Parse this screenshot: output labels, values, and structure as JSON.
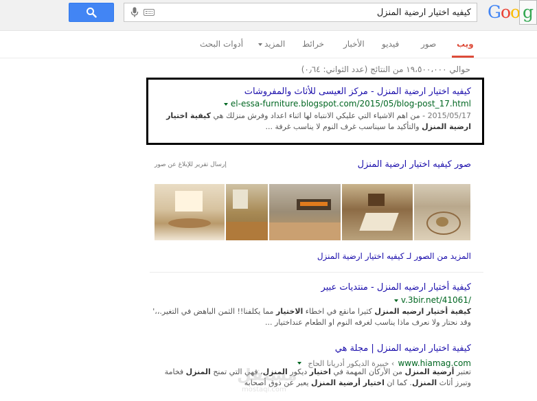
{
  "search": {
    "query": "كيفيه اختيار ارضية المنزل",
    "logo_text": "Goo"
  },
  "tabs": [
    {
      "label": "ويب",
      "active": true
    },
    {
      "label": "صور"
    },
    {
      "label": "فيديو"
    },
    {
      "label": "الأخبار"
    },
    {
      "label": "خرائط"
    },
    {
      "label": "المزيد"
    },
    {
      "label": "أدوات البحث"
    }
  ],
  "stats": "حوالي ١٩،٥٠٠،٠٠٠ من النتائج (عدد الثواني: ٠٫٦٤)",
  "result1": {
    "title": "كيفيه اختيار ارضية المنزل - مركز العيسى للأثاث والمفروشات",
    "url": "el-essa-furniture.blogspot.com/2015/05/blog-post_17.html",
    "date": "2015/05/17",
    "snippet1": " - من اهم الاشياء التي عليكي الانتباه لها اثناء اعداد وفرش منزلك هي ",
    "snippet1_bold": "كيفية اختيار",
    "snippet2_bold": "ارضية المنزل",
    "snippet2": " والتأكيد ما سيناسب غرف النوم لا يناسب غرفة ..."
  },
  "images": {
    "heading": "صور كيفيه اختيار ارضية المنزل",
    "report": "إرسال تقرير للإبلاغ عن صور",
    "more": "المزيد من الصور لـ كيفيه اختيار ارضية المنزل"
  },
  "result2": {
    "title": "كيفية أختيار ارضيه المنزل - منتديات عبير",
    "url": "v.3bir.net/41061/",
    "snippet1_bold": "كيفية أختيار ارضيه المنزل",
    "snippet1": " كثيرا مانقع في اخطاء ",
    "snippet1_bold2": "الاختيار",
    "snippet1b": " مما يكلفنا!! الثمن الباهض في التغير.،،'",
    "snippet2": "وقد نحتار ولا نعرف ماذا يناسب لغرفه النوم او الطعام عنداختيار ..."
  },
  "result3": {
    "title": "كيفية اختيار ارضيه المنزل | مجلة هي",
    "url": "www.hiamag.com",
    "url_extra": "› خبيرة الديكور أدريانا الحاج",
    "snippet1": "تعتبر ",
    "snippet1_bold": "أرضية المنزل",
    "snippet1b": " من الأركان المهمة في ",
    "snippet1_bold2": "اختيار",
    "snippet1c": " ديكور ",
    "snippet1_bold3": "المنزل",
    "snippet1d": "، فهي التي تمنح ",
    "snippet1_bold4": "المنزل",
    "snippet1e": " فخامة",
    "snippet2": "وتبرز أثاث ",
    "snippet2_bold": "المنزل",
    "snippet2b": ". كما ان ",
    "snippet2_bold2": "اختيار أرضية المنزل",
    "snippet2c": " يعبر عن ذوق أصحابه"
  },
  "watermark": "مستقل",
  "watermark_sub": "mostaql.com",
  "colors": {
    "link": "#1a0dab",
    "url": "#006621",
    "active_tab": "#dd4b39",
    "search_button": "#4285f4"
  }
}
